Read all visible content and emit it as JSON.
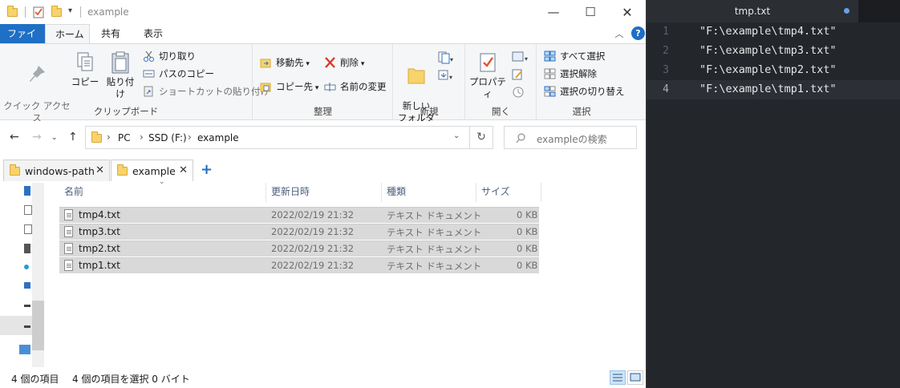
{
  "explorer": {
    "title": "example",
    "ribbon_tabs": [
      "ファイル",
      "ホーム",
      "共有",
      "表示"
    ],
    "help": "?",
    "ribbon": {
      "clipboard": {
        "label": "クリップボード",
        "pin": "クイック アクセス\nにピン留めする",
        "copy": "コピー",
        "paste": "貼り付け",
        "cut": "切り取り",
        "copy_path": "パスのコピー",
        "paste_shortcut": "ショートカットの貼り付け"
      },
      "organize": {
        "label": "整理",
        "move_to": "移動先",
        "copy_to": "コピー先",
        "delete": "削除",
        "rename": "名前の変更"
      },
      "new": {
        "label": "新規",
        "new_folder": "新しい\nフォルダー"
      },
      "open": {
        "label": "開く",
        "properties": "プロパティ"
      },
      "select": {
        "label": "選択",
        "select_all": "すべて選択",
        "select_none": "選択解除",
        "invert": "選択の切り替え"
      }
    },
    "address": {
      "crumbs": [
        "PC",
        "SSD (F:)",
        "example"
      ],
      "search_placeholder": "exampleの検索"
    },
    "tabs": [
      {
        "label": "windows-path",
        "active": false
      },
      {
        "label": "example",
        "active": true
      }
    ],
    "columns": [
      "名前",
      "更新日時",
      "種類",
      "サイズ"
    ],
    "files": [
      {
        "name": "tmp4.txt",
        "date": "2022/02/19 21:32",
        "type": "テキスト ドキュメント",
        "size": "0 KB"
      },
      {
        "name": "tmp3.txt",
        "date": "2022/02/19 21:32",
        "type": "テキスト ドキュメント",
        "size": "0 KB"
      },
      {
        "name": "tmp2.txt",
        "date": "2022/02/19 21:32",
        "type": "テキスト ドキュメント",
        "size": "0 KB"
      },
      {
        "name": "tmp1.txt",
        "date": "2022/02/19 21:32",
        "type": "テキスト ドキュメント",
        "size": "0 KB"
      }
    ],
    "status": {
      "count": "4 個の項目",
      "selection": "4 個の項目を選択  0 バイト"
    }
  },
  "editor": {
    "tab_title": "tmp.txt",
    "lines": [
      {
        "number": "1",
        "text": "\"F:\\example\\tmp4.txt\""
      },
      {
        "number": "2",
        "text": "\"F:\\example\\tmp3.txt\""
      },
      {
        "number": "3",
        "text": "\"F:\\example\\tmp2.txt\""
      },
      {
        "number": "4",
        "text": "\"F:\\example\\tmp1.txt\""
      }
    ],
    "current_line": 4
  },
  "colors": {
    "accent": "#1f6fc5",
    "selection": "#d9d9d9",
    "editor_bg": "#23262b",
    "dirty_dot": "#6d9de8"
  }
}
